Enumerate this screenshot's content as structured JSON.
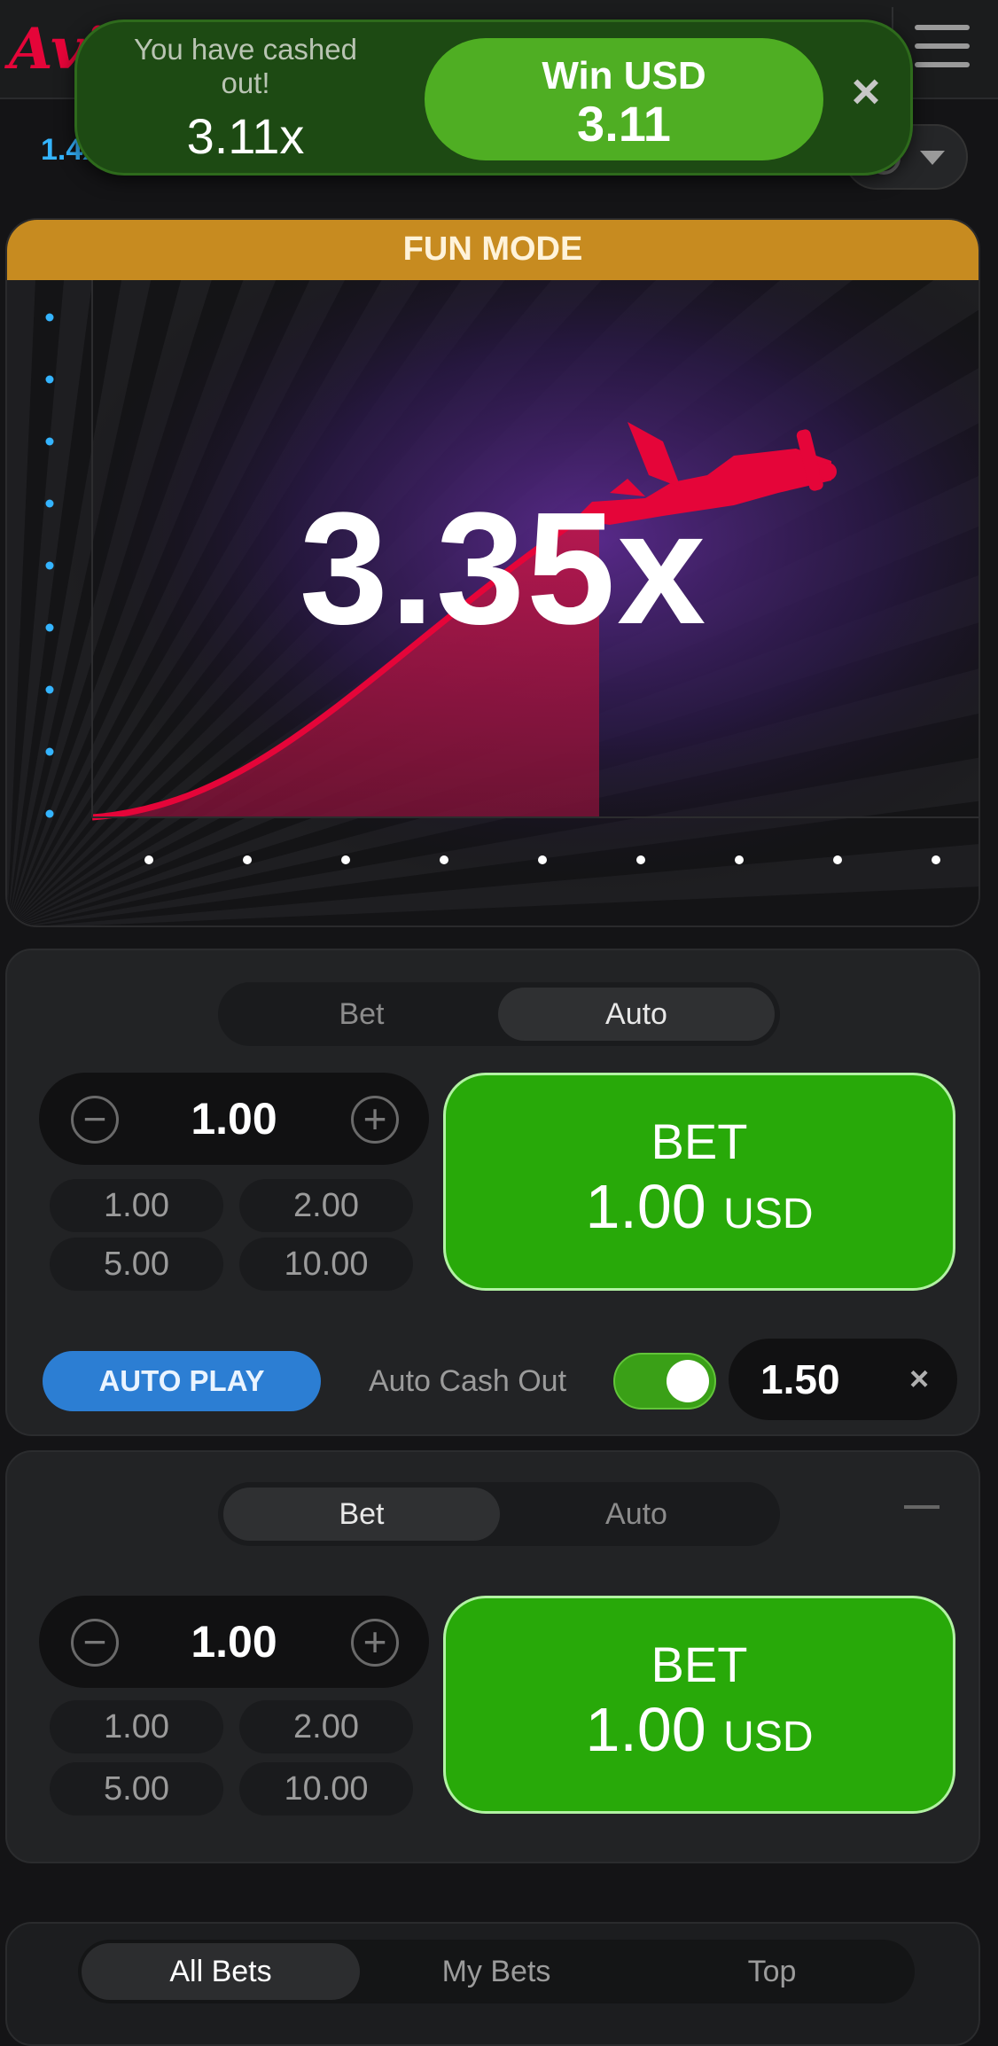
{
  "header": {
    "logo": "Avi"
  },
  "history": {
    "first": "1.4x"
  },
  "toast": {
    "message": "You have cashed out!",
    "multiplier": "3.11x",
    "win_label": "Win USD",
    "win_amount": "3.11",
    "close": "×"
  },
  "game": {
    "banner": "FUN MODE",
    "multiplier": "3.35x",
    "colors": {
      "curve": "#e50539",
      "banner": "#c78b20",
      "y_dots": "#34b4ff"
    }
  },
  "panel1": {
    "tabs": [
      "Bet",
      "Auto"
    ],
    "active_tab": 1,
    "amount": "1.00",
    "quick": [
      "1.00",
      "2.00",
      "5.00",
      "10.00"
    ],
    "bet_label": "BET",
    "bet_amount": "1.00",
    "bet_currency": "USD",
    "autoplay_label": "AUTO PLAY",
    "auto_cashout_label": "Auto Cash Out",
    "auto_cashout_enabled": true,
    "auto_cashout_value": "1.50",
    "clear": "×"
  },
  "panel2": {
    "tabs": [
      "Bet",
      "Auto"
    ],
    "active_tab": 0,
    "amount": "1.00",
    "quick": [
      "1.00",
      "2.00",
      "5.00",
      "10.00"
    ],
    "bet_label": "BET",
    "bet_amount": "1.00",
    "bet_currency": "USD"
  },
  "bets_tabs": [
    "All Bets",
    "My Bets",
    "Top"
  ],
  "colors": {
    "accent_green": "#28a909",
    "brand_red": "#e50539",
    "autoplay_blue": "#2c7ed3"
  }
}
